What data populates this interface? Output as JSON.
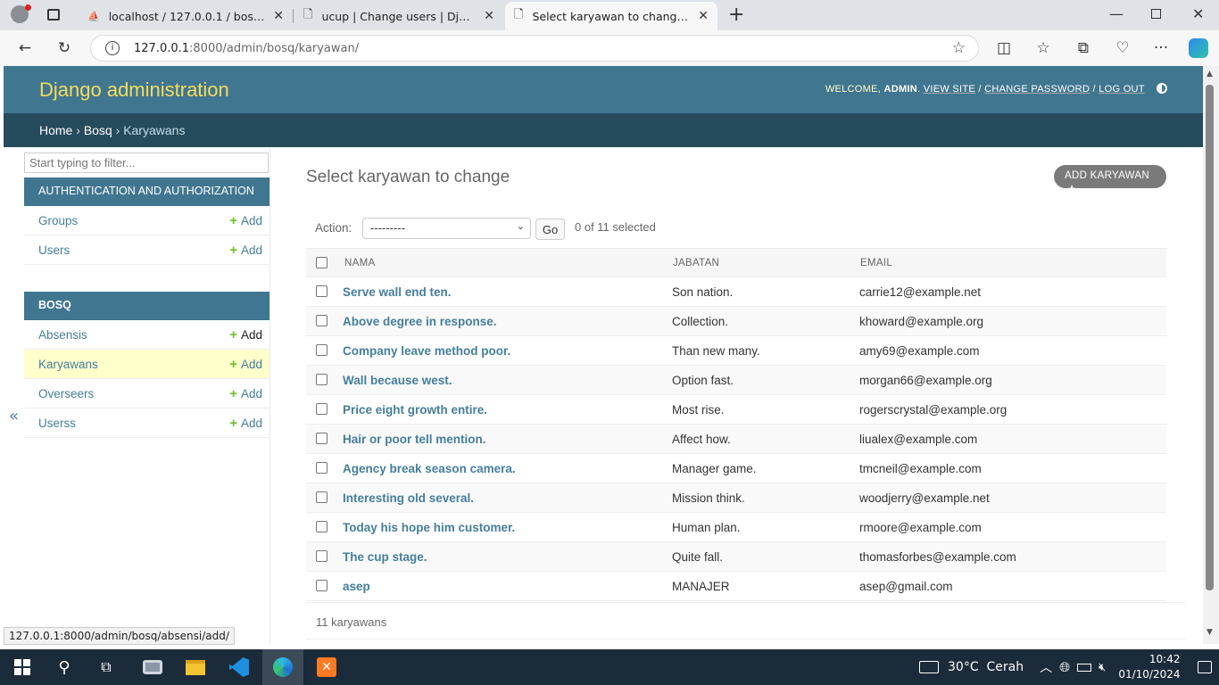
{
  "browser": {
    "tabs": [
      {
        "title": "localhost / 127.0.0.1 / bosq / djan"
      },
      {
        "title": "ucup | Change users | Django site"
      },
      {
        "title": "Select karyawan to change | Djang"
      }
    ],
    "url_host": "127.0.0.1",
    "url_rest": ":8000/admin/bosq/karyawan/"
  },
  "header": {
    "brand": "Django administration",
    "welcome": "WELCOME,",
    "user": "ADMIN",
    "view_site": "VIEW SITE",
    "change_password": "CHANGE PASSWORD",
    "log_out": "LOG OUT"
  },
  "breadcrumbs": {
    "home": "Home",
    "app": "Bosq",
    "current": "Karyawans"
  },
  "sidebar": {
    "filter_placeholder": "Start typing to filter...",
    "apps": [
      {
        "caption": "AUTHENTICATION AND AUTHORIZATION",
        "models": [
          {
            "label": "Groups",
            "add": "Add"
          },
          {
            "label": "Users",
            "add": "Add"
          }
        ]
      },
      {
        "caption": "BOSQ",
        "models": [
          {
            "label": "Absensis",
            "add": "Add"
          },
          {
            "label": "Karyawans",
            "add": "Add"
          },
          {
            "label": "Overseers",
            "add": "Add"
          },
          {
            "label": "Userss",
            "add": "Add"
          }
        ]
      }
    ],
    "collapse": "«"
  },
  "main": {
    "title": "Select karyawan to change",
    "add_button": "ADD KARYAWAN",
    "action_label": "Action:",
    "action_value": "---------",
    "go": "Go",
    "counter": "0 of 11 selected",
    "columns": [
      "NAMA",
      "JABATAN",
      "EMAIL"
    ],
    "rows": [
      {
        "nama": "Serve wall end ten.",
        "jabatan": "Son nation.",
        "email": "carrie12@example.net"
      },
      {
        "nama": "Above degree in response.",
        "jabatan": "Collection.",
        "email": "khoward@example.org"
      },
      {
        "nama": "Company leave method poor.",
        "jabatan": "Than new many.",
        "email": "amy69@example.com"
      },
      {
        "nama": "Wall because west.",
        "jabatan": "Option fast.",
        "email": "morgan66@example.org"
      },
      {
        "nama": "Price eight growth entire.",
        "jabatan": "Most rise.",
        "email": "rogerscrystal@example.org"
      },
      {
        "nama": "Hair or poor tell mention.",
        "jabatan": "Affect how.",
        "email": "liualex@example.com"
      },
      {
        "nama": "Agency break season camera.",
        "jabatan": "Manager game.",
        "email": "tmcneil@example.com"
      },
      {
        "nama": "Interesting old several.",
        "jabatan": "Mission think.",
        "email": "woodjerry@example.net"
      },
      {
        "nama": "Today his hope him customer.",
        "jabatan": "Human plan.",
        "email": "rmoore@example.com"
      },
      {
        "nama": "The cup stage.",
        "jabatan": "Quite fall.",
        "email": "thomasforbes@example.com"
      },
      {
        "nama": "asep",
        "jabatan": "MANAJER",
        "email": "asep@gmail.com"
      }
    ],
    "paginator": "11 karyawans"
  },
  "status_url": "127.0.0.1:8000/admin/bosq/absensi/add/",
  "taskbar": {
    "weather": "30°C  Cerah",
    "time": "10:42",
    "date": "01/10/2024"
  },
  "colors": {
    "header": "#417690",
    "breadcrumbs": "#264b5d",
    "brand": "#f5dd5d",
    "link": "#447e9b",
    "add_plus": "#70bf2b",
    "current_row": "#ffffcc"
  }
}
